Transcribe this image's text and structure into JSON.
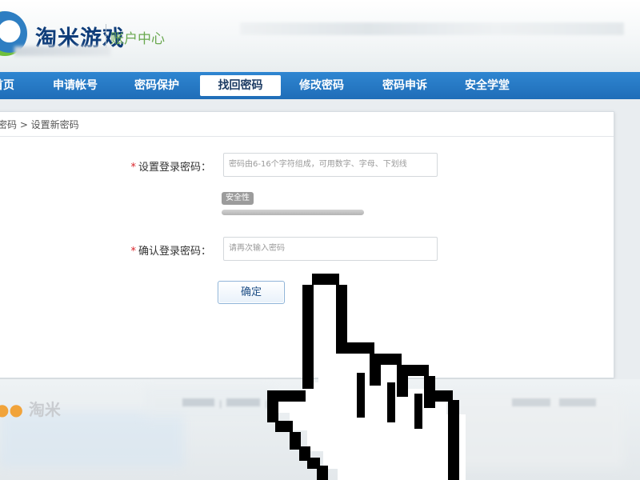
{
  "header": {
    "logo_text": "淘米游戏",
    "logo_sub": "账户中心"
  },
  "nav": {
    "items": [
      {
        "label": "首页"
      },
      {
        "label": "申请帐号"
      },
      {
        "label": "密码保护"
      },
      {
        "label": "找回密码"
      },
      {
        "label": "修改密码"
      },
      {
        "label": "密码申诉"
      },
      {
        "label": "安全学堂"
      }
    ],
    "active_index": 3
  },
  "breadcrumb": {
    "text": "密码 > 设置新密码"
  },
  "form": {
    "password_label": "设置登录密码：",
    "password_placeholder": "密码由6-16个字符组成，可用数字、字母、下划线",
    "password_value": "",
    "strength_label": "安全性",
    "confirm_label": "确认登录密码：",
    "confirm_placeholder": "请再次输入密码",
    "confirm_value": "",
    "required_mark": "*",
    "submit_label": "确定"
  },
  "footer": {
    "logo_text": "淘米"
  },
  "colors": {
    "nav_bg": "#1f6db8",
    "required": "#d9242a",
    "logo_green": "#6aa84f"
  }
}
